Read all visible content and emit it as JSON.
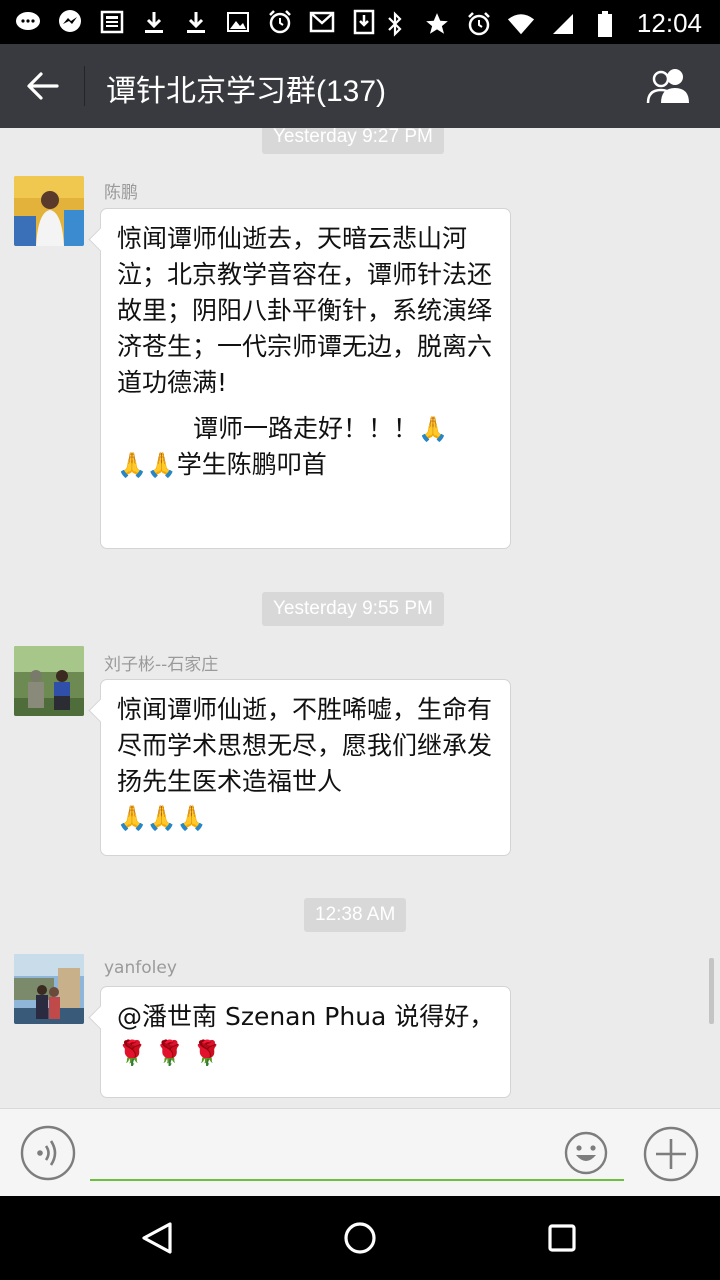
{
  "status_bar": {
    "time": "12:04",
    "left_icons": [
      "chat-bubble-icon",
      "messenger-icon",
      "news-icon",
      "download-icon",
      "download-icon",
      "image-icon",
      "alarm-icon",
      "gmail-icon",
      "download-box-icon"
    ],
    "right_icons": [
      "bluetooth-icon",
      "star-icon",
      "alarm-icon",
      "wifi-icon",
      "signal-icon",
      "battery-icon"
    ]
  },
  "header": {
    "title": "谭针北京学习群(137)",
    "bg_color": "#393a3f"
  },
  "messages": [
    {
      "time": "Yesterday 9:27 PM",
      "sender": "陈鹏",
      "text": "惊闻谭师仙逝去，天暗云悲山河泣；北京教学音容在，谭师针法还故里；阴阳八卦平衡针，系统演绎济苍生；一代宗师谭无边，脱离六道功德满!",
      "text2": "谭师一路走好！！！",
      "text2_emoji": "🙏",
      "text3_emoji": "🙏🙏",
      "text3": "学生陈鹏叩首"
    },
    {
      "time": "Yesterday 9:55 PM",
      "sender": "刘子彬--石家庄",
      "text": "惊闻谭师仙逝，不胜唏嘘，生命有尽而学术思想无尽，愿我们继承发扬先生医术造福世人",
      "emoji": "🙏🙏🙏"
    },
    {
      "time": "12:38 AM",
      "sender": "yanfoley",
      "text": "@潘世南 Szenan Phua 说得好，",
      "emoji": "🌹 🌹 🌹"
    }
  ],
  "input": {
    "value": "",
    "accent_color": "#6fbf3f"
  }
}
